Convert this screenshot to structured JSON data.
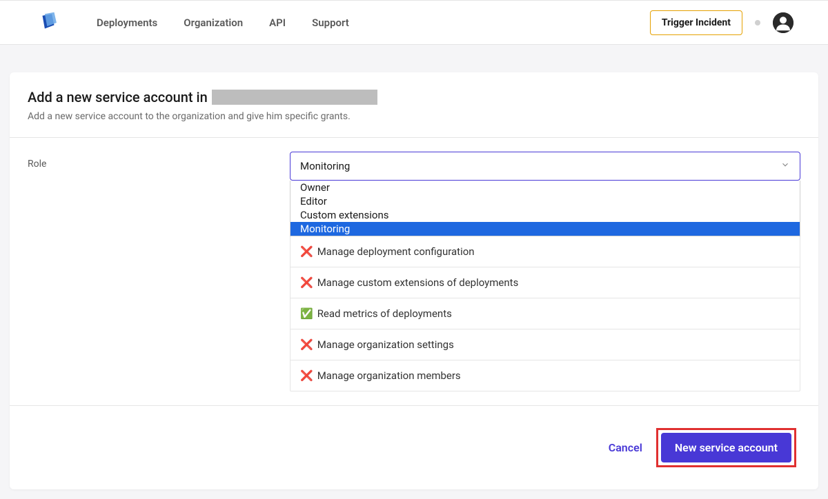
{
  "topbar": {
    "nav": [
      "Deployments",
      "Organization",
      "API",
      "Support"
    ],
    "trigger_label": "Trigger Incident"
  },
  "card": {
    "title_prefix": "Add a new service account in",
    "subtitle": "Add a new service account to the organization and give him specific grants."
  },
  "form": {
    "role_label": "Role",
    "selected_role": "Monitoring",
    "role_options": [
      "Owner",
      "Editor",
      "Custom extensions",
      "Monitoring"
    ]
  },
  "permissions": [
    {
      "allowed": false,
      "label": "Manage deployment configuration"
    },
    {
      "allowed": false,
      "label": "Manage custom extensions of deployments"
    },
    {
      "allowed": true,
      "label": "Read metrics of deployments"
    },
    {
      "allowed": false,
      "label": "Manage organization settings"
    },
    {
      "allowed": false,
      "label": "Manage organization members"
    }
  ],
  "footer": {
    "cancel_label": "Cancel",
    "submit_label": "New service account"
  },
  "icons": {
    "check": "✅",
    "cross": "❌"
  }
}
